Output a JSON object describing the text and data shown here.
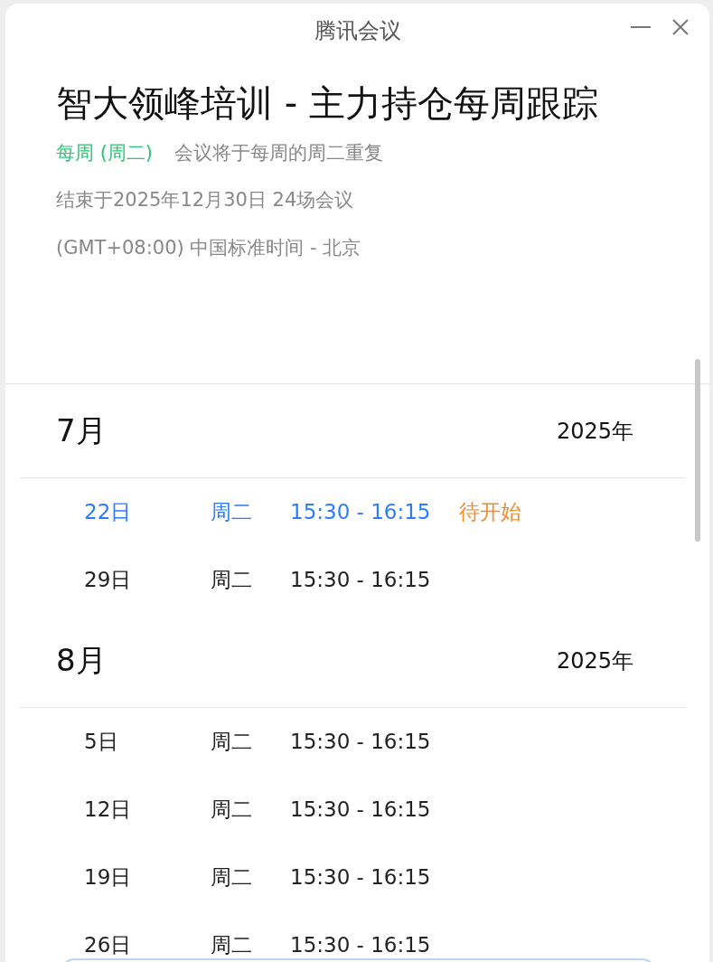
{
  "window": {
    "title": "腾讯会议"
  },
  "meeting": {
    "title": "智大领峰培训 - 主力持仓每周跟踪",
    "recurrence": "每周 (周二)",
    "recurrence_note": "会议将于每周的周二重复",
    "end_info": "结束于2025年12月30日 24场会议",
    "timezone": "(GMT+08:00) 中国标准时间 - 北京"
  },
  "months": [
    {
      "month": "7月",
      "year": "2025年",
      "occurrences": [
        {
          "day": "22日",
          "weekday": "周二",
          "time": "15:30 - 16:15",
          "status": "待开始",
          "selected": true
        },
        {
          "day": "29日",
          "weekday": "周二",
          "time": "15:30 - 16:15",
          "selected": false
        }
      ]
    },
    {
      "month": "8月",
      "year": "2025年",
      "occurrences": [
        {
          "day": "5日",
          "weekday": "周二",
          "time": "15:30 - 16:15",
          "selected": false
        },
        {
          "day": "12日",
          "weekday": "周二",
          "time": "15:30 - 16:15",
          "selected": false
        },
        {
          "day": "19日",
          "weekday": "周二",
          "time": "15:30 - 16:15",
          "selected": false
        },
        {
          "day": "26日",
          "weekday": "周二",
          "time": "15:30 - 16:15",
          "selected": false
        }
      ]
    }
  ]
}
